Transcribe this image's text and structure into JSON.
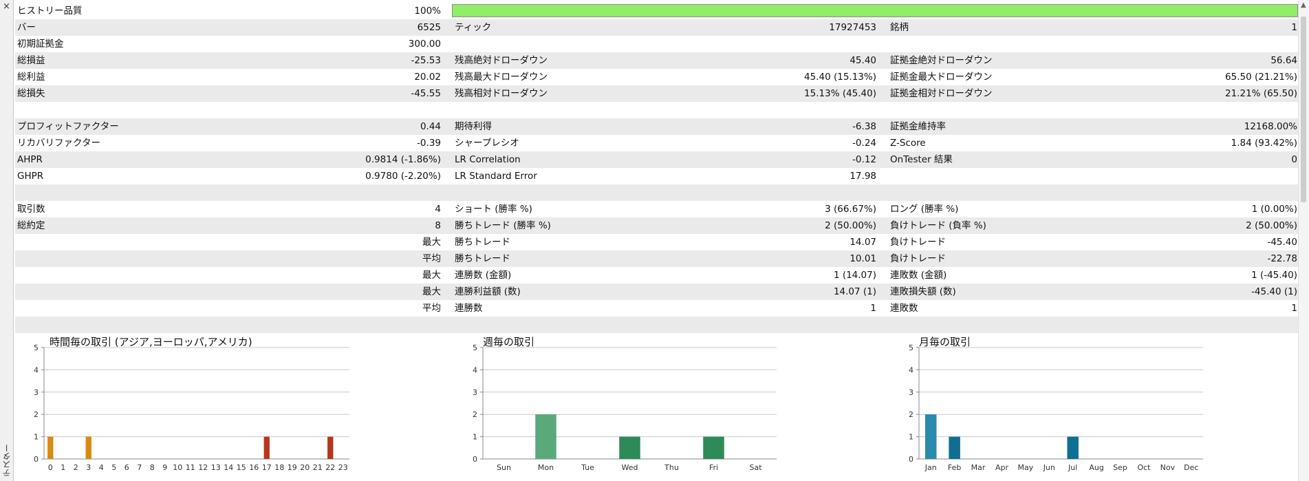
{
  "sidebar": {
    "close_label": "×",
    "vertical_label": "テスター"
  },
  "history_quality": {
    "label": "ヒストリー品質",
    "value": "100%",
    "fill_fraction": 1.0,
    "fill_color": "#90ee68"
  },
  "stats_rows": [
    {
      "shade": true,
      "c1": [
        "バー",
        "6525"
      ],
      "c2": [
        "ティック",
        "17927453"
      ],
      "c3": [
        "銘柄",
        "1"
      ]
    },
    {
      "shade": false,
      "c1": [
        "初期証拠金",
        "300.00"
      ],
      "c2": [
        "",
        ""
      ],
      "c3": [
        "",
        ""
      ]
    },
    {
      "shade": true,
      "c1": [
        "総損益",
        "-25.53"
      ],
      "c2": [
        "残高絶対ドローダウン",
        "45.40"
      ],
      "c3": [
        "証拠金絶対ドローダウン",
        "56.64"
      ]
    },
    {
      "shade": false,
      "c1": [
        "総利益",
        "20.02"
      ],
      "c2": [
        "残高最大ドローダウン",
        "45.40 (15.13%)"
      ],
      "c3": [
        "証拠金最大ドローダウン",
        "65.50 (21.21%)"
      ]
    },
    {
      "shade": true,
      "c1": [
        "総損失",
        "-45.55"
      ],
      "c2": [
        "残高相対ドローダウン",
        "15.13% (45.40)"
      ],
      "c3": [
        "証拠金相対ドローダウン",
        "21.21% (65.50)"
      ]
    },
    {
      "shade": false,
      "c1": [
        "",
        ""
      ],
      "c2": [
        "",
        ""
      ],
      "c3": [
        "",
        ""
      ]
    },
    {
      "shade": true,
      "c1": [
        "プロフィットファクター",
        "0.44"
      ],
      "c2": [
        "期待利得",
        "-6.38"
      ],
      "c3": [
        "証拠金維持率",
        "12168.00%"
      ]
    },
    {
      "shade": false,
      "c1": [
        "リカバリファクター",
        "-0.39"
      ],
      "c2": [
        "シャープレシオ",
        "-0.24"
      ],
      "c3": [
        "Z-Score",
        "1.84 (93.42%)"
      ]
    },
    {
      "shade": true,
      "c1": [
        "AHPR",
        "0.9814 (-1.86%)"
      ],
      "c2": [
        "LR Correlation",
        "-0.12"
      ],
      "c3": [
        "OnTester 結果",
        "0"
      ]
    },
    {
      "shade": false,
      "c1": [
        "GHPR",
        "0.9780 (-2.20%)"
      ],
      "c2": [
        "LR Standard Error",
        "17.98"
      ],
      "c3": [
        "",
        ""
      ]
    },
    {
      "shade": true,
      "c1": [
        "",
        ""
      ],
      "c2": [
        "",
        ""
      ],
      "c3": [
        "",
        ""
      ]
    },
    {
      "shade": false,
      "c1": [
        "取引数",
        "4"
      ],
      "c2": [
        "ショート (勝率 %)",
        "3 (66.67%)"
      ],
      "c3": [
        "ロング (勝率 %)",
        "1 (0.00%)"
      ]
    },
    {
      "shade": true,
      "c1": [
        "総約定",
        "8"
      ],
      "c2": [
        "勝ちトレード (勝率 %)",
        "2 (50.00%)"
      ],
      "c3": [
        "負けトレード (負率 %)",
        "2 (50.00%)"
      ]
    },
    {
      "shade": false,
      "c1": [
        "",
        "最大"
      ],
      "c2": [
        "勝ちトレード",
        "14.07"
      ],
      "c3": [
        "負けトレード",
        "-45.40"
      ]
    },
    {
      "shade": true,
      "c1": [
        "",
        "平均"
      ],
      "c2": [
        "勝ちトレード",
        "10.01"
      ],
      "c3": [
        "負けトレード",
        "-22.78"
      ]
    },
    {
      "shade": false,
      "c1": [
        "",
        "最大"
      ],
      "c2": [
        "連勝数 (金額)",
        "1 (14.07)"
      ],
      "c3": [
        "連敗数 (金額)",
        "1 (-45.40)"
      ]
    },
    {
      "shade": true,
      "c1": [
        "",
        "最大"
      ],
      "c2": [
        "連勝利益額 (数)",
        "14.07 (1)"
      ],
      "c3": [
        "連敗損失額 (数)",
        "-45.40 (1)"
      ]
    },
    {
      "shade": false,
      "c1": [
        "",
        "平均"
      ],
      "c2": [
        "連勝数",
        "1"
      ],
      "c3": [
        "連敗数",
        "1"
      ]
    },
    {
      "shade": true,
      "c1": [
        "",
        ""
      ],
      "c2": [
        "",
        ""
      ],
      "c3": [
        "",
        ""
      ]
    }
  ],
  "chart_data": [
    {
      "type": "bar",
      "title": "時間毎の取引 (アジア,ヨーロッパ,アメリカ)",
      "categories": [
        "0",
        "1",
        "2",
        "3",
        "4",
        "5",
        "6",
        "7",
        "8",
        "9",
        "10",
        "11",
        "12",
        "13",
        "14",
        "15",
        "16",
        "17",
        "18",
        "19",
        "20",
        "21",
        "22",
        "23"
      ],
      "values": [
        1,
        0,
        0,
        1,
        0,
        0,
        0,
        0,
        0,
        0,
        0,
        0,
        0,
        0,
        0,
        0,
        0,
        1,
        0,
        0,
        0,
        0,
        1,
        0
      ],
      "bar_colors": [
        "#d88a10",
        "#d88a10",
        "#d88a10",
        "#d88a10",
        "#d88a10",
        "#d88a10",
        "#d88a10",
        "#d88a10",
        "#d88a10",
        "#d88a10",
        "#d88a10",
        "#d88a10",
        "#d88a10",
        "#d88a10",
        "#d88a10",
        "#d88a10",
        "#d88a10",
        "#b5381c",
        "#b5381c",
        "#b5381c",
        "#b5381c",
        "#b5381c",
        "#b5381c",
        "#b5381c"
      ],
      "ylim": [
        0,
        5
      ],
      "yticks": [
        0,
        1,
        2,
        3,
        4,
        5
      ],
      "grid": true
    },
    {
      "type": "bar",
      "title": "週毎の取引",
      "categories": [
        "Sun",
        "Mon",
        "Tue",
        "Wed",
        "Thu",
        "Fri",
        "Sat"
      ],
      "values": [
        0,
        2,
        0,
        1,
        0,
        1,
        0
      ],
      "bar_colors": [
        "#2e8b57",
        "#5aa97b",
        "#2e8b57",
        "#2e8b57",
        "#2e8b57",
        "#2e8b57",
        "#2e8b57"
      ],
      "ylim": [
        0,
        5
      ],
      "yticks": [
        0,
        1,
        2,
        3,
        4,
        5
      ],
      "grid": true
    },
    {
      "type": "bar",
      "title": "月毎の取引",
      "categories": [
        "Jan",
        "Feb",
        "Mar",
        "Apr",
        "May",
        "Jun",
        "Jul",
        "Aug",
        "Sep",
        "Oct",
        "Nov",
        "Dec"
      ],
      "values": [
        2,
        1,
        0,
        0,
        0,
        0,
        1,
        0,
        0,
        0,
        0,
        0
      ],
      "bar_colors": [
        "#2a8aab",
        "#0f6f92",
        "#0f6f92",
        "#0f6f92",
        "#0f6f92",
        "#0f6f92",
        "#0f6f92",
        "#0f6f92",
        "#0f6f92",
        "#0f6f92",
        "#0f6f92",
        "#0f6f92"
      ],
      "ylim": [
        0,
        5
      ],
      "yticks": [
        0,
        1,
        2,
        3,
        4,
        5
      ],
      "grid": true
    }
  ]
}
